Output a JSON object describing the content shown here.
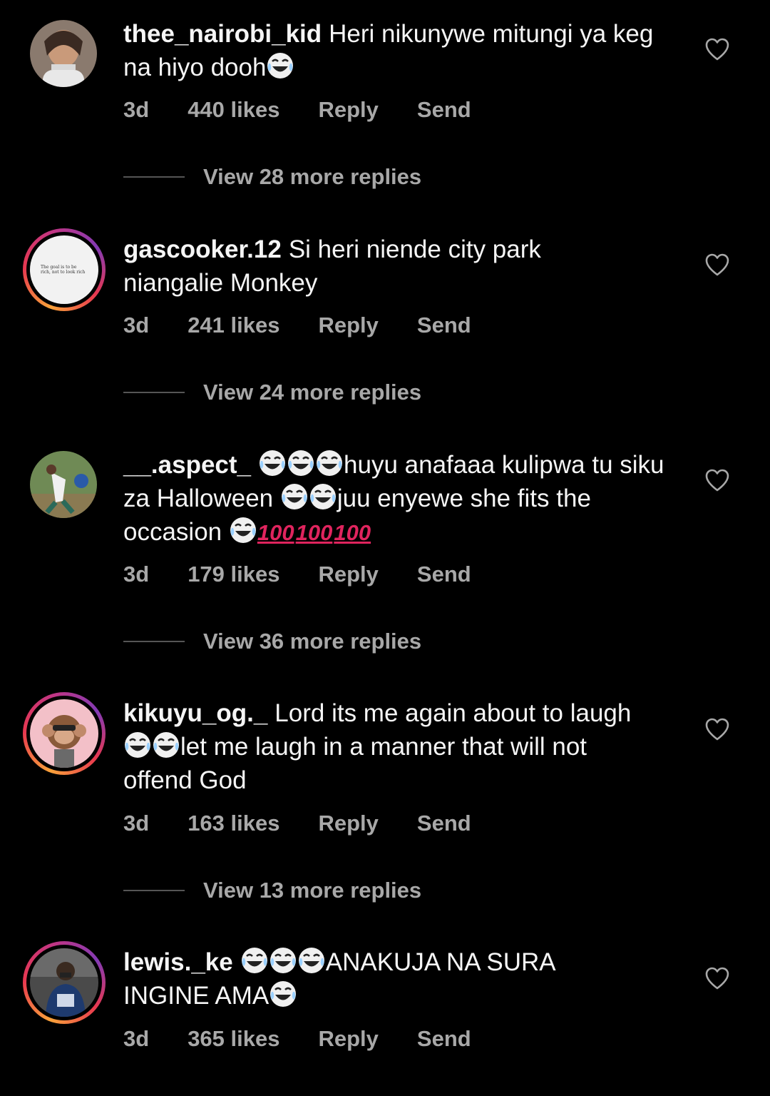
{
  "comments": [
    {
      "username": "thee_nairobi_kid",
      "text1": "Heri nikunywe mitungi ya keg na hiyo dooh",
      "age": "3d",
      "likes": "440 likes",
      "reply": "Reply",
      "send": "Send",
      "view_replies": "View 28 more replies"
    },
    {
      "username": "gascooker.12",
      "text1": "Si heri niende city park niangalie Monkey",
      "age": "3d",
      "likes": "241 likes",
      "reply": "Reply",
      "send": "Send",
      "view_replies": "View 24 more replies",
      "avatar_text": "The goal is to be rich, not to look rich"
    },
    {
      "username": "__.aspect_",
      "text1": "huyu anafaaa kulipwa tu siku za Halloween",
      "text2": "juu enyewe she fits the occasion",
      "hundreds": [
        "100",
        "100",
        "100"
      ],
      "age": "3d",
      "likes": "179 likes",
      "reply": "Reply",
      "send": "Send",
      "view_replies": "View 36 more replies"
    },
    {
      "username": "kikuyu_og._",
      "text1": "Lord its me again about to laugh",
      "text2": "let me laugh in a manner that will not offend God",
      "age": "3d",
      "likes": "163 likes",
      "reply": "Reply",
      "send": "Send",
      "view_replies": "View 13 more replies"
    },
    {
      "username": "lewis._ke",
      "text1": "ANAKUJA NA SURA INGINE AMA",
      "age": "3d",
      "likes": "365 likes",
      "reply": "Reply",
      "send": "Send"
    }
  ],
  "colors": {
    "background": "#000000",
    "text": "#f5f5f5",
    "secondary": "#a8a8a8",
    "story_ring": "#e8384f"
  },
  "icons": {
    "like": "heart-outline-icon",
    "emoji": "tears-of-joy-emoji"
  }
}
